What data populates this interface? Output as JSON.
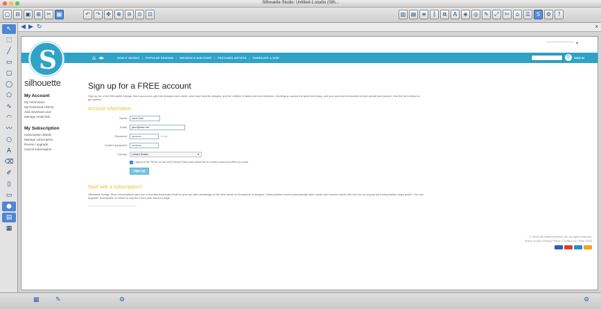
{
  "window": {
    "title": "Silhouette Studio: Untitled-1.studio (Silh..."
  },
  "browser": {
    "back": "◀",
    "forward": "▶",
    "refresh": "↻",
    "close": "×"
  },
  "site": {
    "brand": "silhouette",
    "language": "",
    "nav": [
      "HOW IT WORKS",
      "POPULAR DESIGNS",
      "BROWSE & DISCOVER",
      "FEATURED ARTISTS",
      "FABRICATE & SHIP"
    ],
    "signin": "SIGN IN",
    "colors": {
      "accent": "#2fa3c6",
      "section": "#f2b92c"
    }
  },
  "sidebar": {
    "account_title": "My Account",
    "account_items": [
      "My Information",
      "My Download History",
      "Add download card",
      "Manage email lists"
    ],
    "subscription_title": "My Subscription",
    "subscription_items": [
      "Subscription details",
      "Manage subscription",
      "Renew / upgrade",
      "Cancel subscription"
    ]
  },
  "main": {
    "title": "Sign up for a FREE account",
    "intro": "Sign up for a free Silhouette Design Store account to get free designs each week, save your favorite designs, and be notified of sales and new releases. Creating an account is quick and easy, and your account information is kept private and secure. Use the form below to get started.",
    "section_account": "Account information",
    "fields": {
      "name_label": "Name",
      "name_value": "Jane Doe",
      "email_label": "Email",
      "email_value": "jane@doe.net",
      "password_label": "Password",
      "password_value": "••••••••••",
      "password_hint": "6 min.",
      "confirm_label": "Confirm password",
      "confirm_value": "••••••••••",
      "country_label": "Country",
      "country_value": "United States"
    },
    "agree_text": "I agree to the Terms of Use and Privacy Policy and would like to receive news and offers by email.",
    "signup_button": "Sign up",
    "section_subscription": "Start with a subscription?",
    "subscription_text": "Silhouette Design Store subscriptions give you a monthly download credit so you can take advantage of the best deals on thousands of designs. Subscriptions renew automatically each month and unused credit rolls over for as long as your subscription stays active. You can upgrade, downgrade or cancel at any time from your account page."
  },
  "footer": {
    "copyright": "© 2016 Silhouette America, Inc. All rights reserved.",
    "links": "Terms of Use | Privacy Policy | Contact Us | Help | FAQ",
    "cards": [
      "#2c5fad",
      "#e33b2f",
      "#1f8fd6",
      "#f7a21b"
    ]
  }
}
